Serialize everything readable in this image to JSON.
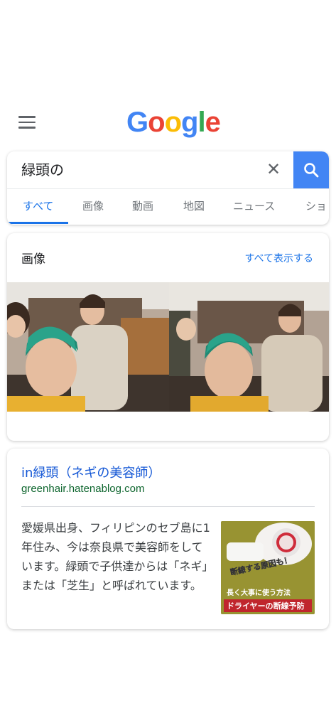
{
  "header": {
    "logo_text": "Google",
    "menu_icon": "hamburger-menu-icon"
  },
  "search": {
    "query": "緑頭の",
    "clear_icon": "close-icon",
    "search_icon": "search-icon"
  },
  "tabs": [
    {
      "label": "すべて",
      "active": true
    },
    {
      "label": "画像"
    },
    {
      "label": "動画"
    },
    {
      "label": "地図"
    },
    {
      "label": "ニュース"
    },
    {
      "label": "ショ"
    }
  ],
  "images_section": {
    "title": "画像",
    "show_all_label": "すべて表示する"
  },
  "result": {
    "title": "in緑頭（ネギの美容師）",
    "url": "greenhair.hatenablog.com",
    "snippet": "愛媛県出身、フィリピンのセブ島に1年住み、今は奈良県で美容師をしています。緑頭で子供達からは「ネギ」または「芝生」と呼ばれています。",
    "thumbnail": {
      "caption_top": "断線する原因も！",
      "caption_mid": "長く大事に使う方法",
      "caption_bottom": "ドライヤーの断線予防"
    }
  },
  "colors": {
    "accent": "#4285f4",
    "link": "#1558d6",
    "url": "#0d652d",
    "active_tab": "#1a73e8"
  }
}
